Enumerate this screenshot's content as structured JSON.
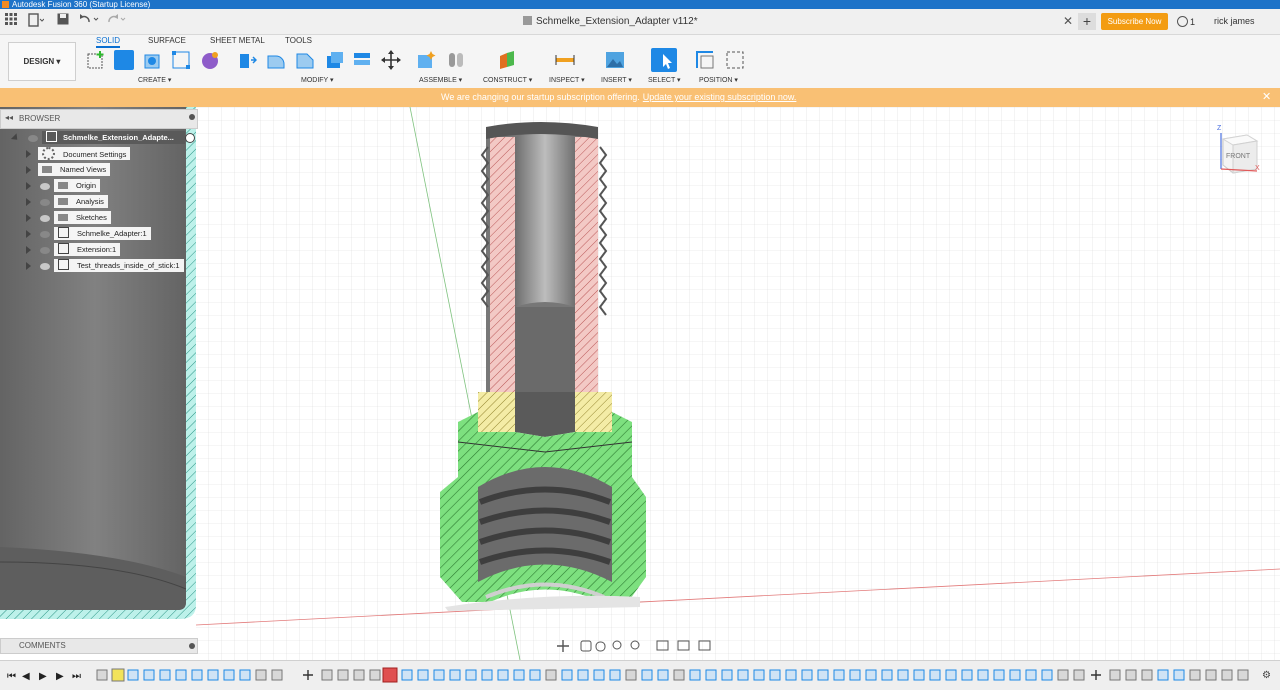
{
  "window": {
    "title": "Autodesk Fusion 360 (Startup License)"
  },
  "appbar": {
    "document_title": "Schmelke_Extension_Adapter v112*",
    "close_tab": "✕",
    "new_tab": "+",
    "subscribe_label": "Subscribe Now",
    "jobs_count": "1",
    "user_name": "rick james"
  },
  "toolbar": {
    "workspace": "DESIGN ▾",
    "tabs": [
      "SOLID",
      "SURFACE",
      "SHEET METAL",
      "TOOLS"
    ],
    "groups": {
      "create": "CREATE ▾",
      "modify": "MODIFY ▾",
      "assemble": "ASSEMBLE ▾",
      "construct": "CONSTRUCT ▾",
      "inspect": "INSPECT ▾",
      "insert": "INSERT ▾",
      "select": "SELECT ▾",
      "position": "POSITION ▾"
    }
  },
  "banner": {
    "message": "We are changing our startup subscription offering.",
    "link": "Update your existing subscription now.",
    "close": "✕"
  },
  "browser": {
    "title": "BROWSER",
    "root": "Schmelke_Extension_Adapte...",
    "items": [
      {
        "label": "Document Settings",
        "icon": "gear-icon"
      },
      {
        "label": "Named Views",
        "icon": "folder-icon"
      },
      {
        "label": "Origin",
        "icon": "folder-icon"
      },
      {
        "label": "Analysis",
        "icon": "folder-icon"
      },
      {
        "label": "Sketches",
        "icon": "folder-icon"
      },
      {
        "label": "Schmelke_Adapter:1",
        "icon": "component-icon"
      },
      {
        "label": "Extension:1",
        "icon": "component-icon"
      },
      {
        "label": "Test_threads_inside_of_stick:1",
        "icon": "component-icon"
      }
    ]
  },
  "comments": {
    "title": "COMMENTS"
  },
  "viewcube": {
    "face": "FRONT",
    "z": "Z",
    "x": "X"
  },
  "colors": {
    "accent": "#0b6fd1",
    "banner": "#f9c074",
    "subscribe": "#f39c12",
    "section_green": "#7de07f",
    "section_pink": "#f3c9c5",
    "section_yellow": "#f4eca6",
    "body_grey": "#7a7a7a"
  }
}
